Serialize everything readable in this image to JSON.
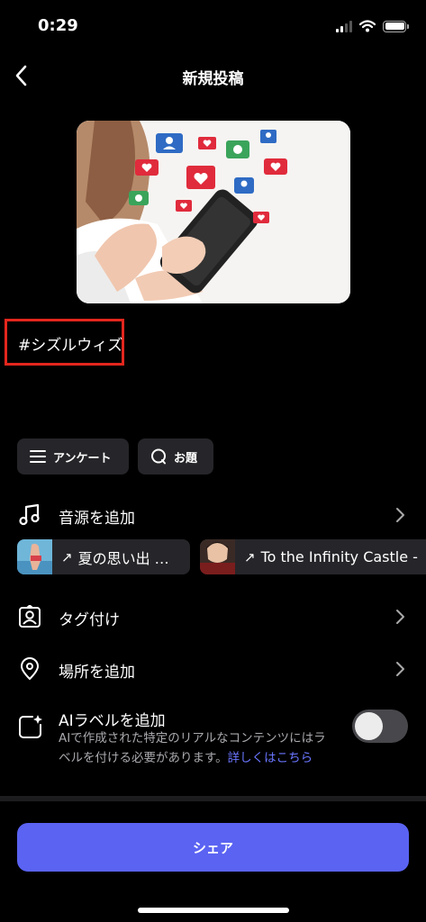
{
  "status_bar": {
    "time": "0:29"
  },
  "nav": {
    "title": "新規投稿"
  },
  "post": {
    "caption": "#シズルウィズ"
  },
  "chips": {
    "poll": "アンケート",
    "topic": "お題"
  },
  "rows": {
    "music": "音源を追加",
    "tag": "タグ付け",
    "location": "場所を追加"
  },
  "music_suggestions": [
    {
      "name": "夏の思い出 …"
    },
    {
      "name": "To the Infinity Castle -"
    }
  ],
  "ai_label": {
    "title": "AIラベルを追加",
    "description": "AIで作成された特定のリアルなコンテンツにはラベルを付ける必要があります。",
    "link": "詳しくはこちら",
    "enabled": false
  },
  "share_button": "シェア",
  "colors": {
    "accent": "#5a63f2",
    "link": "#6a76ff",
    "highlight_border": "#e3261d"
  }
}
